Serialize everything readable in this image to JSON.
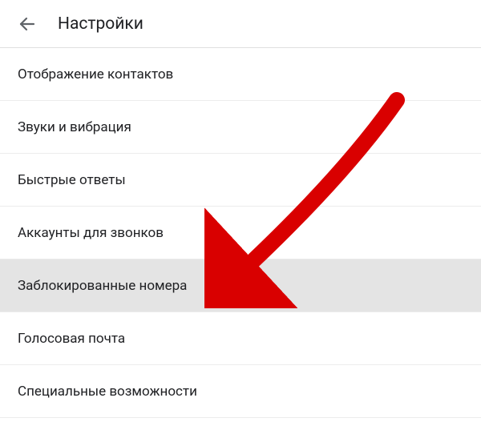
{
  "header": {
    "title": "Настройки"
  },
  "menu": {
    "items": [
      {
        "label": "Отображение контактов",
        "highlighted": false
      },
      {
        "label": "Звуки и вибрация",
        "highlighted": false
      },
      {
        "label": "Быстрые ответы",
        "highlighted": false
      },
      {
        "label": "Аккаунты для звонков",
        "highlighted": false
      },
      {
        "label": "Заблокированные номера",
        "highlighted": true
      },
      {
        "label": "Голосовая почта",
        "highlighted": false
      },
      {
        "label": "Специальные возможности",
        "highlighted": false
      }
    ]
  },
  "annotation": {
    "arrow_color": "#d90000",
    "target_item_index": 4
  }
}
